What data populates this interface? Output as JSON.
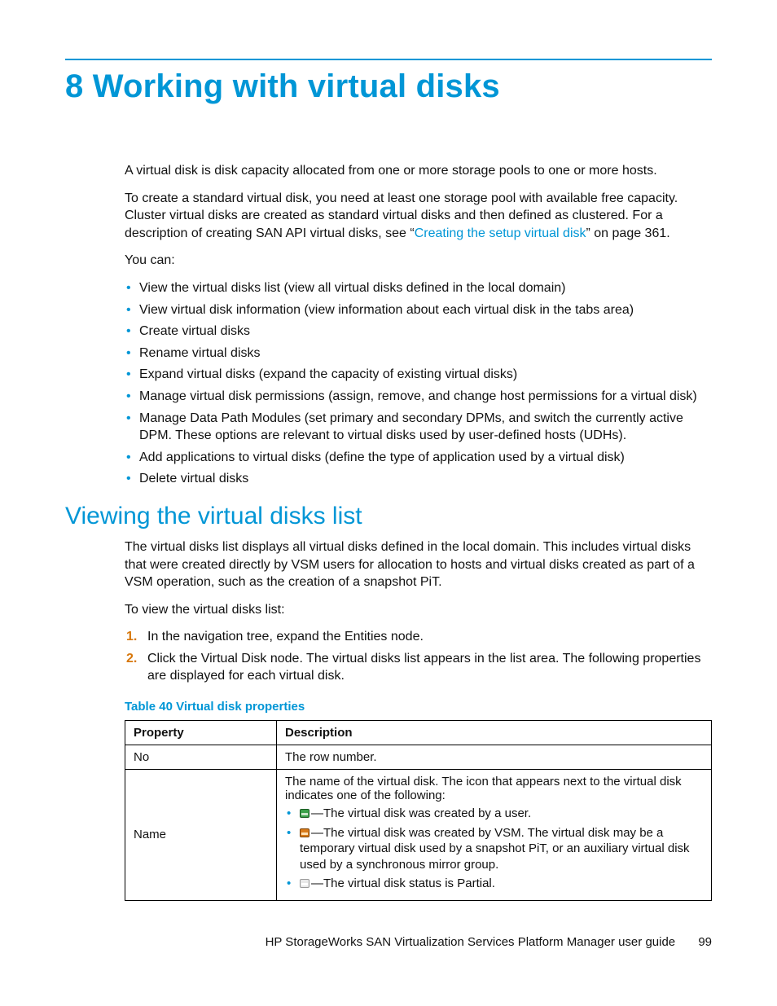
{
  "chapter": {
    "number": "8",
    "title": "Working with virtual disks"
  },
  "intro": {
    "p1": "A virtual disk is disk capacity allocated from one or more storage pools to one or more hosts.",
    "p2a": "To create a standard virtual disk, you need at least one storage pool with available free capacity. Cluster virtual disks are created as standard virtual disks and then defined as clustered. For a description of creating SAN API virtual disks, see “",
    "p2_link": "Creating the setup virtual disk",
    "p2b": "” on page 361.",
    "youcan": "You can:",
    "bullets": [
      "View the virtual disks list (view all virtual disks defined in the local domain)",
      "View virtual disk information (view information about each virtual disk in the tabs area)",
      "Create virtual disks",
      "Rename virtual disks",
      "Expand virtual disks (expand the capacity of existing virtual disks)",
      "Manage virtual disk permissions (assign, remove, and change host permissions for a virtual disk)",
      "Manage Data Path Modules (set primary and secondary DPMs, and switch the currently active DPM. These options are relevant to virtual disks used by user-defined hosts (UDHs).",
      "Add applications to virtual disks (define the type of application used by a virtual disk)",
      "Delete virtual disks"
    ]
  },
  "section1": {
    "title": "Viewing the virtual disks list",
    "p1": "The virtual disks list displays all virtual disks defined in the local domain. This includes virtual disks that were created directly by VSM users for allocation to hosts and virtual disks created as part of a VSM operation, such as the creation of a snapshot PiT.",
    "p2": "To view the virtual disks list:",
    "steps": [
      "In the navigation tree, expand the Entities node.",
      "Click the Virtual Disk node. The virtual disks list appears in the list area. The following properties are displayed for each virtual disk."
    ]
  },
  "table": {
    "caption": "Table 40 Virtual disk properties",
    "head_property": "Property",
    "head_description": "Description",
    "rows": {
      "no": {
        "prop": "No",
        "desc": "The row number."
      },
      "name": {
        "prop": "Name",
        "lead": "The name of the virtual disk. The icon that appears next to the virtual disk indicates one of the following:",
        "items": [
          "—The virtual disk was created by a user.",
          "—The virtual disk was created by VSM. The virtual disk may be a temporary virtual disk used by a snapshot PiT, or an auxiliary virtual disk used by a synchronous mirror group.",
          "—The virtual disk status is Partial."
        ]
      }
    }
  },
  "footer": {
    "text": "HP StorageWorks SAN Virtualization Services Platform Manager user guide",
    "page": "99"
  }
}
